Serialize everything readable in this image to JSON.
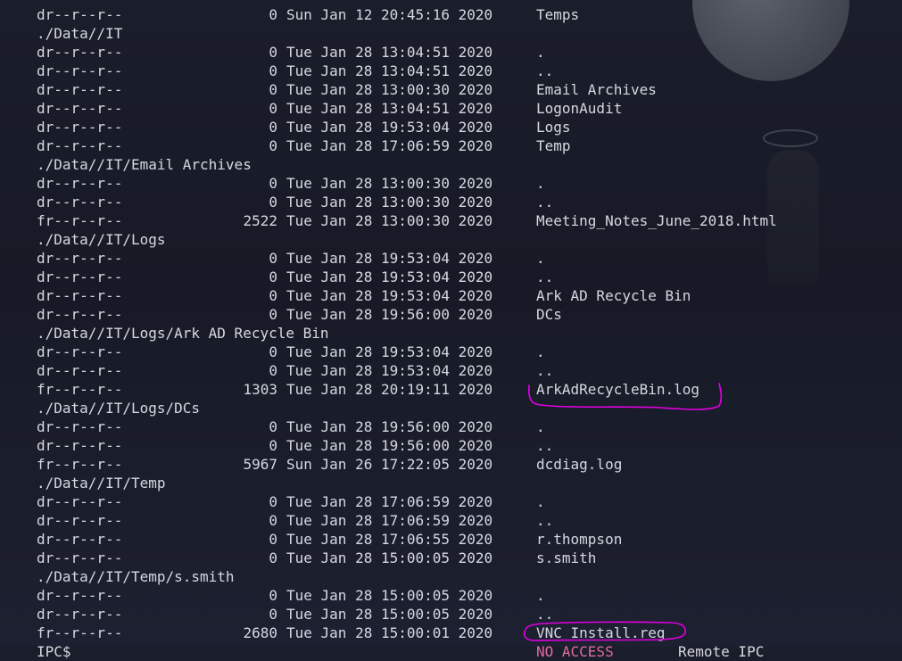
{
  "theme": {
    "text_color": "#d6d8e0",
    "annotation_color": "#e000e0",
    "error_color": "#e06c9f"
  },
  "lines": [
    {
      "perm": "dr--r--r--",
      "size": "0",
      "date": "Sun Jan 12 20:45:16 2020",
      "name": "Temps"
    },
    {
      "path": "./Data//IT"
    },
    {
      "perm": "dr--r--r--",
      "size": "0",
      "date": "Tue Jan 28 13:04:51 2020",
      "name": "."
    },
    {
      "perm": "dr--r--r--",
      "size": "0",
      "date": "Tue Jan 28 13:04:51 2020",
      "name": ".."
    },
    {
      "perm": "dr--r--r--",
      "size": "0",
      "date": "Tue Jan 28 13:00:30 2020",
      "name": "Email Archives"
    },
    {
      "perm": "dr--r--r--",
      "size": "0",
      "date": "Tue Jan 28 13:04:51 2020",
      "name": "LogonAudit"
    },
    {
      "perm": "dr--r--r--",
      "size": "0",
      "date": "Tue Jan 28 19:53:04 2020",
      "name": "Logs"
    },
    {
      "perm": "dr--r--r--",
      "size": "0",
      "date": "Tue Jan 28 17:06:59 2020",
      "name": "Temp"
    },
    {
      "path": "./Data//IT/Email Archives"
    },
    {
      "perm": "dr--r--r--",
      "size": "0",
      "date": "Tue Jan 28 13:00:30 2020",
      "name": "."
    },
    {
      "perm": "dr--r--r--",
      "size": "0",
      "date": "Tue Jan 28 13:00:30 2020",
      "name": ".."
    },
    {
      "perm": "fr--r--r--",
      "size": "2522",
      "date": "Tue Jan 28 13:00:30 2020",
      "name": "Meeting_Notes_June_2018.html"
    },
    {
      "path": "./Data//IT/Logs"
    },
    {
      "perm": "dr--r--r--",
      "size": "0",
      "date": "Tue Jan 28 19:53:04 2020",
      "name": "."
    },
    {
      "perm": "dr--r--r--",
      "size": "0",
      "date": "Tue Jan 28 19:53:04 2020",
      "name": ".."
    },
    {
      "perm": "dr--r--r--",
      "size": "0",
      "date": "Tue Jan 28 19:53:04 2020",
      "name": "Ark AD Recycle Bin"
    },
    {
      "perm": "dr--r--r--",
      "size": "0",
      "date": "Tue Jan 28 19:56:00 2020",
      "name": "DCs"
    },
    {
      "path": "./Data//IT/Logs/Ark AD Recycle Bin"
    },
    {
      "perm": "dr--r--r--",
      "size": "0",
      "date": "Tue Jan 28 19:53:04 2020",
      "name": "."
    },
    {
      "perm": "dr--r--r--",
      "size": "0",
      "date": "Tue Jan 28 19:53:04 2020",
      "name": ".."
    },
    {
      "perm": "fr--r--r--",
      "size": "1303",
      "date": "Tue Jan 28 20:19:11 2020",
      "name": "ArkAdRecycleBin.log"
    },
    {
      "path": "./Data//IT/Logs/DCs"
    },
    {
      "perm": "dr--r--r--",
      "size": "0",
      "date": "Tue Jan 28 19:56:00 2020",
      "name": "."
    },
    {
      "perm": "dr--r--r--",
      "size": "0",
      "date": "Tue Jan 28 19:56:00 2020",
      "name": ".."
    },
    {
      "perm": "fr--r--r--",
      "size": "5967",
      "date": "Sun Jan 26 17:22:05 2020",
      "name": "dcdiag.log"
    },
    {
      "path": "./Data//IT/Temp"
    },
    {
      "perm": "dr--r--r--",
      "size": "0",
      "date": "Tue Jan 28 17:06:59 2020",
      "name": "."
    },
    {
      "perm": "dr--r--r--",
      "size": "0",
      "date": "Tue Jan 28 17:06:59 2020",
      "name": ".."
    },
    {
      "perm": "dr--r--r--",
      "size": "0",
      "date": "Tue Jan 28 17:06:55 2020",
      "name": "r.thompson"
    },
    {
      "perm": "dr--r--r--",
      "size": "0",
      "date": "Tue Jan 28 15:00:05 2020",
      "name": "s.smith"
    },
    {
      "path": "./Data//IT/Temp/s.smith"
    },
    {
      "perm": "dr--r--r--",
      "size": "0",
      "date": "Tue Jan 28 15:00:05 2020",
      "name": "."
    },
    {
      "perm": "dr--r--r--",
      "size": "0",
      "date": "Tue Jan 28 15:00:05 2020",
      "name": ".."
    },
    {
      "perm": "fr--r--r--",
      "size": "2680",
      "date": "Tue Jan 28 15:00:01 2020",
      "name": "VNC Install.reg"
    }
  ],
  "bottom_line": {
    "share": "IPC$",
    "access": "NO ACCESS",
    "comment": "Remote IPC"
  }
}
